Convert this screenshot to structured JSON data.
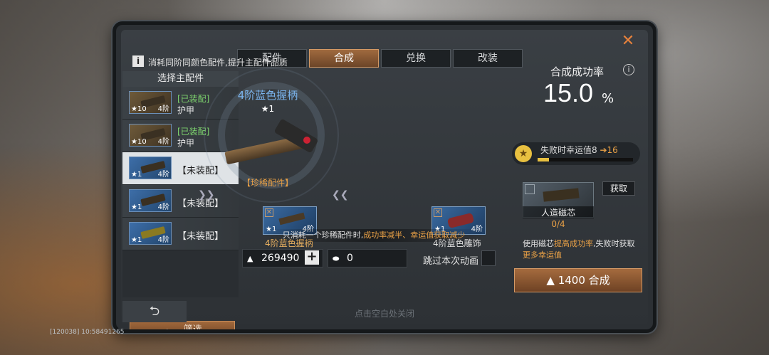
{
  "tabs": [
    {
      "label": "配件"
    },
    {
      "label": "合成"
    },
    {
      "label": "兑换"
    },
    {
      "label": "改装"
    }
  ],
  "active_tab": "合成",
  "sidebar": {
    "title": "选择主配件",
    "items": [
      {
        "status": "[已装配]",
        "type": "护甲",
        "tier": "4阶",
        "stars": "★10"
      },
      {
        "status": "[已装配]",
        "type": "护甲",
        "tier": "4阶",
        "stars": "★10"
      },
      {
        "label": "【未装配】",
        "tier": "4阶",
        "stars": "★1"
      },
      {
        "label": "【未装配】",
        "tier": "4阶",
        "stars": "★1"
      },
      {
        "label": "【未装配】",
        "tier": "4阶",
        "stars": "★1"
      }
    ],
    "filter_label": "筛选"
  },
  "info_text": "消耗同阶同颜色配件,提升主配件品质",
  "main_part": {
    "name": "4阶蓝色握柄",
    "stars": "★1",
    "rarity_tag": "【珍稀配件】"
  },
  "materials": [
    {
      "name": "4阶蓝色握柄",
      "stars": "★1",
      "tier": "4阶"
    },
    {
      "name": "4阶蓝色雕饰",
      "stars": "★1",
      "tier": "4阶"
    }
  ],
  "warning": {
    "pre": "只消耗一个珍稀配件时,",
    "highlight": "成功率减半、幸运值获取减少"
  },
  "resources": {
    "currency": "269490",
    "tokens": "0"
  },
  "skip_label": "跳过本次动画",
  "success_rate": {
    "label": "合成成功率",
    "value": "15.0",
    "unit": "%"
  },
  "luck": {
    "text": "失败时幸运值8",
    "arrow": "➔16",
    "progress": 0.12
  },
  "core": {
    "acquire_label": "获取",
    "name": "人造磁芯",
    "count": "0/4",
    "desc_pre": "使用磁芯",
    "desc_hl1": "提高成功率",
    "desc_mid": ",失败时获取",
    "desc_hl2": "更多幸运值"
  },
  "synth_button": "1400 合成",
  "footer_hint": "点击空白处关闭",
  "hud": "[120038] 10:58491265",
  "colors": {
    "accent": "#a06a3e",
    "highlight": "#e8a046",
    "blue_name": "#7ab4ee"
  }
}
